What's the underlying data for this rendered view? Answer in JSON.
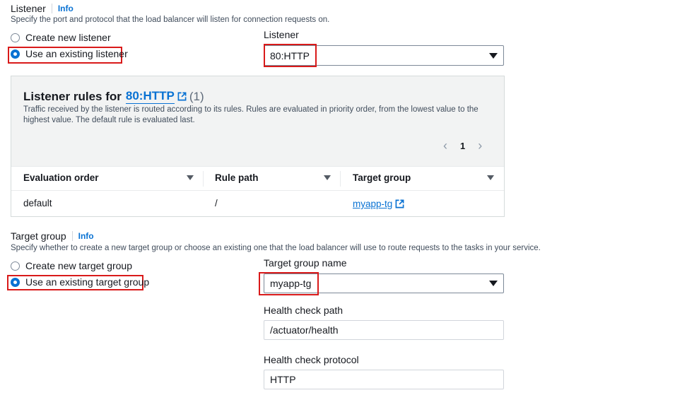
{
  "listener_section": {
    "label": "Listener",
    "info": "Info",
    "description": "Specify the port and protocol that the load balancer will listen for connection requests on.",
    "options": [
      "Create new listener",
      "Use an existing listener"
    ],
    "selected_option": "Use an existing listener",
    "select_label": "Listener",
    "select_value": "80:HTTP"
  },
  "rules_panel": {
    "title_prefix": "Listener rules for",
    "title_link": "80:HTTP",
    "count": "(1)",
    "description": "Traffic received by the listener is routed according to its rules. Rules are evaluated in priority order, from the lowest value to the highest value. The default rule is evaluated last.",
    "page": "1",
    "columns": [
      "Evaluation order",
      "Rule path",
      "Target group"
    ],
    "rows": [
      {
        "evaluation_order": "default",
        "rule_path": "/",
        "target_group": "myapp-tg"
      }
    ]
  },
  "target_group_section": {
    "label": "Target group",
    "info": "Info",
    "description": "Specify whether to create a new target group or choose an existing one that the load balancer will use to route requests to the tasks in your service.",
    "options": [
      "Create new target group",
      "Use an existing target group"
    ],
    "selected_option": "Use an existing target group",
    "name_label": "Target group name",
    "name_value": "myapp-tg",
    "health_path_label": "Health check path",
    "health_path_value": "/actuator/health",
    "health_protocol_label": "Health check protocol",
    "health_protocol_value": "HTTP"
  },
  "colors": {
    "accent": "#0972d3",
    "highlight": "#d91a1a",
    "panel_bg": "#f2f3f3"
  },
  "icons": [
    "external-link-icon",
    "chevron-left-icon",
    "chevron-right-icon",
    "caret-down-icon",
    "sort-caret-icon"
  ]
}
